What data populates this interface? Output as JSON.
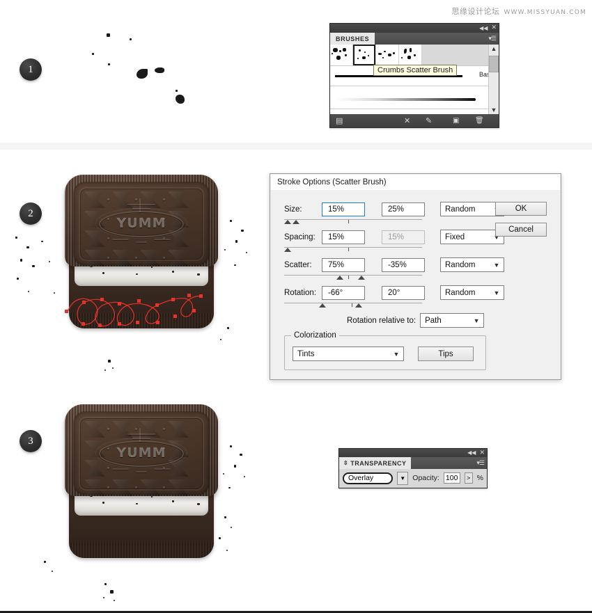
{
  "watermark": {
    "cn": "思缘设计论坛",
    "en": "WWW.MISSYUAN.COM"
  },
  "steps": [
    {
      "label": "1"
    },
    {
      "label": "2"
    },
    {
      "label": "3"
    }
  ],
  "cookie": {
    "emboss_text": "YUMM"
  },
  "brushes_panel": {
    "tab_label": "BRUSHES",
    "collapse_icon": "collapse-icon",
    "close_icon": "close-icon",
    "menu_icon": "panel-menu-icon",
    "tooltip": "Crumbs Scatter Brush",
    "basic_stroke_label": "Basic",
    "brush_thumbs": [
      {
        "name": "brush-thumb-1",
        "selected": false
      },
      {
        "name": "brush-thumb-2",
        "selected": true
      },
      {
        "name": "brush-thumb-3",
        "selected": false
      },
      {
        "name": "brush-thumb-4",
        "selected": false
      }
    ],
    "scrollbar": {
      "up": "▲",
      "down": "▼"
    },
    "footer_icons": [
      {
        "name": "brush-libraries-icon",
        "glyph": "▤"
      },
      {
        "name": "remove-brush-stroke-icon",
        "glyph": "✕"
      },
      {
        "name": "options-of-selected-object-icon",
        "glyph": "✎"
      },
      {
        "name": "new-brush-icon",
        "glyph": "▣"
      },
      {
        "name": "delete-brush-icon",
        "glyph": "🗑"
      }
    ]
  },
  "stroke_options": {
    "title": "Stroke Options (Scatter Brush)",
    "rows": [
      {
        "label": "Size:",
        "value1": "15%",
        "value2": "25%",
        "mode": "Random",
        "v2_disabled": false,
        "v1_focused": true
      },
      {
        "label": "Spacing:",
        "value1": "15%",
        "value2": "15%",
        "mode": "Fixed",
        "v2_disabled": true,
        "v1_focused": false
      },
      {
        "label": "Scatter:",
        "value1": "75%",
        "value2": "-35%",
        "mode": "Random",
        "v2_disabled": false,
        "v1_focused": false
      },
      {
        "label": "Rotation:",
        "value1": "-66°",
        "value2": "20°",
        "mode": "Random",
        "v2_disabled": false,
        "v1_focused": false
      }
    ],
    "rotation_relative_label": "Rotation relative to:",
    "rotation_relative_value": "Path",
    "colorization_legend": "Colorization",
    "colorization_value": "Tints",
    "tips_button": "Tips",
    "ok_button": "OK",
    "cancel_button": "Cancel",
    "accent_focus_color": "#1a7fd4"
  },
  "transparency_panel": {
    "tab_label": "TRANSPARENCY",
    "tab_grip_icon": "panel-grip-icon",
    "collapse_icon": "collapse-icon",
    "close_icon": "close-icon",
    "menu_icon": "panel-menu-icon",
    "blend_mode": "Overlay",
    "opacity_label": "Opacity:",
    "opacity_value": "100",
    "opacity_unit": "%",
    "stepper_glyph": ">"
  }
}
